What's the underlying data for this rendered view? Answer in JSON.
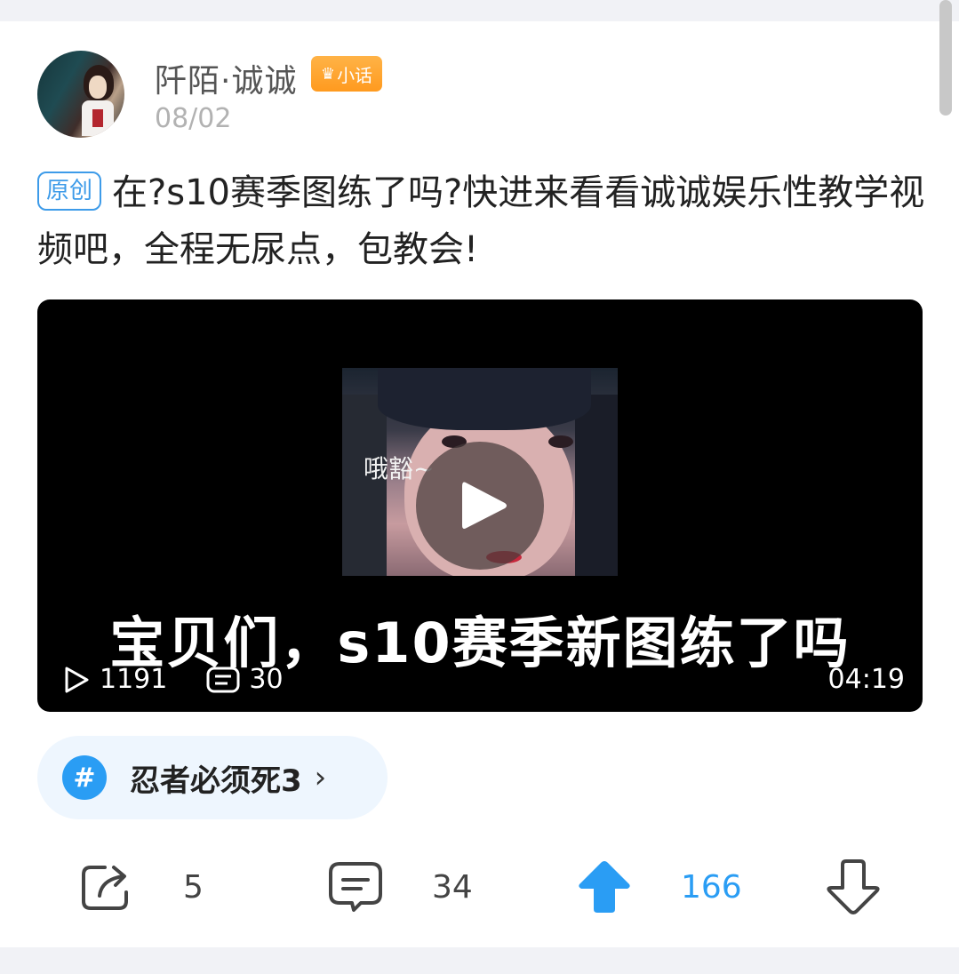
{
  "post": {
    "author": {
      "name": "阡陌·诚诚",
      "badge": "小话"
    },
    "date": "08/02",
    "tag": "原创",
    "text": "在?s10赛季图练了吗?快进来看看诚诚娱乐性教学视频吧，全程无尿点，包教会!"
  },
  "video": {
    "thumbnail_caption": "哦豁~",
    "subtitle": "宝贝们，s10赛季新图练了吗",
    "plays": "1191",
    "danmaku": "30",
    "duration": "04:19"
  },
  "topic": {
    "label": "忍者必须死3",
    "icon": "hash-icon"
  },
  "actions": {
    "share_count": "5",
    "comment_count": "34",
    "upvote_count": "166",
    "upvote_color": "#2a9df4"
  }
}
